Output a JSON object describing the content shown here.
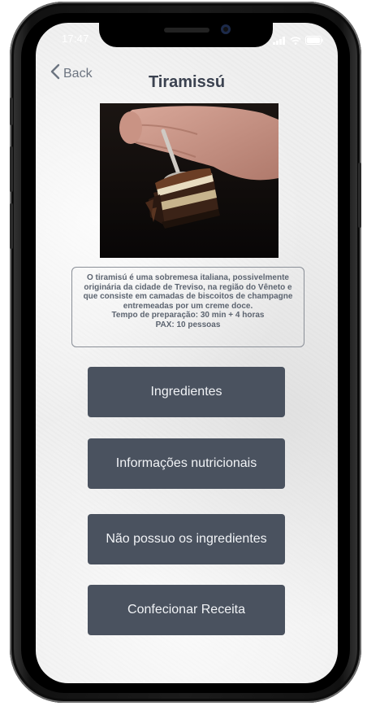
{
  "status_bar": {
    "time": "17:47",
    "icons": [
      "signal-icon",
      "wifi-icon",
      "battery-icon"
    ]
  },
  "nav": {
    "back_label": "Back",
    "title": "Tiramissú"
  },
  "hero": {
    "image_icon": "tiramisu-photo"
  },
  "description": {
    "lines": [
      "O tiramisú é uma sobremesa italiana, possivelmente",
      "originária da cidade de Treviso, na região do Vêneto e",
      "que consiste em camadas de biscoitos de champagne",
      "entremeadas por um creme doce.",
      "Tempo de preparação: 30 min + 4 horas",
      "PAX: 10 pessoas"
    ]
  },
  "buttons": {
    "ingredients": "Ingredientes",
    "nutrition": "Informações nutricionais",
    "missing": "Não possuo os ingredientes",
    "prepare": "Confecionar Receita"
  },
  "colors": {
    "button_bg": "#4a525f",
    "title": "#3b4250",
    "text": "#5c6470",
    "back": "#6c7480"
  }
}
